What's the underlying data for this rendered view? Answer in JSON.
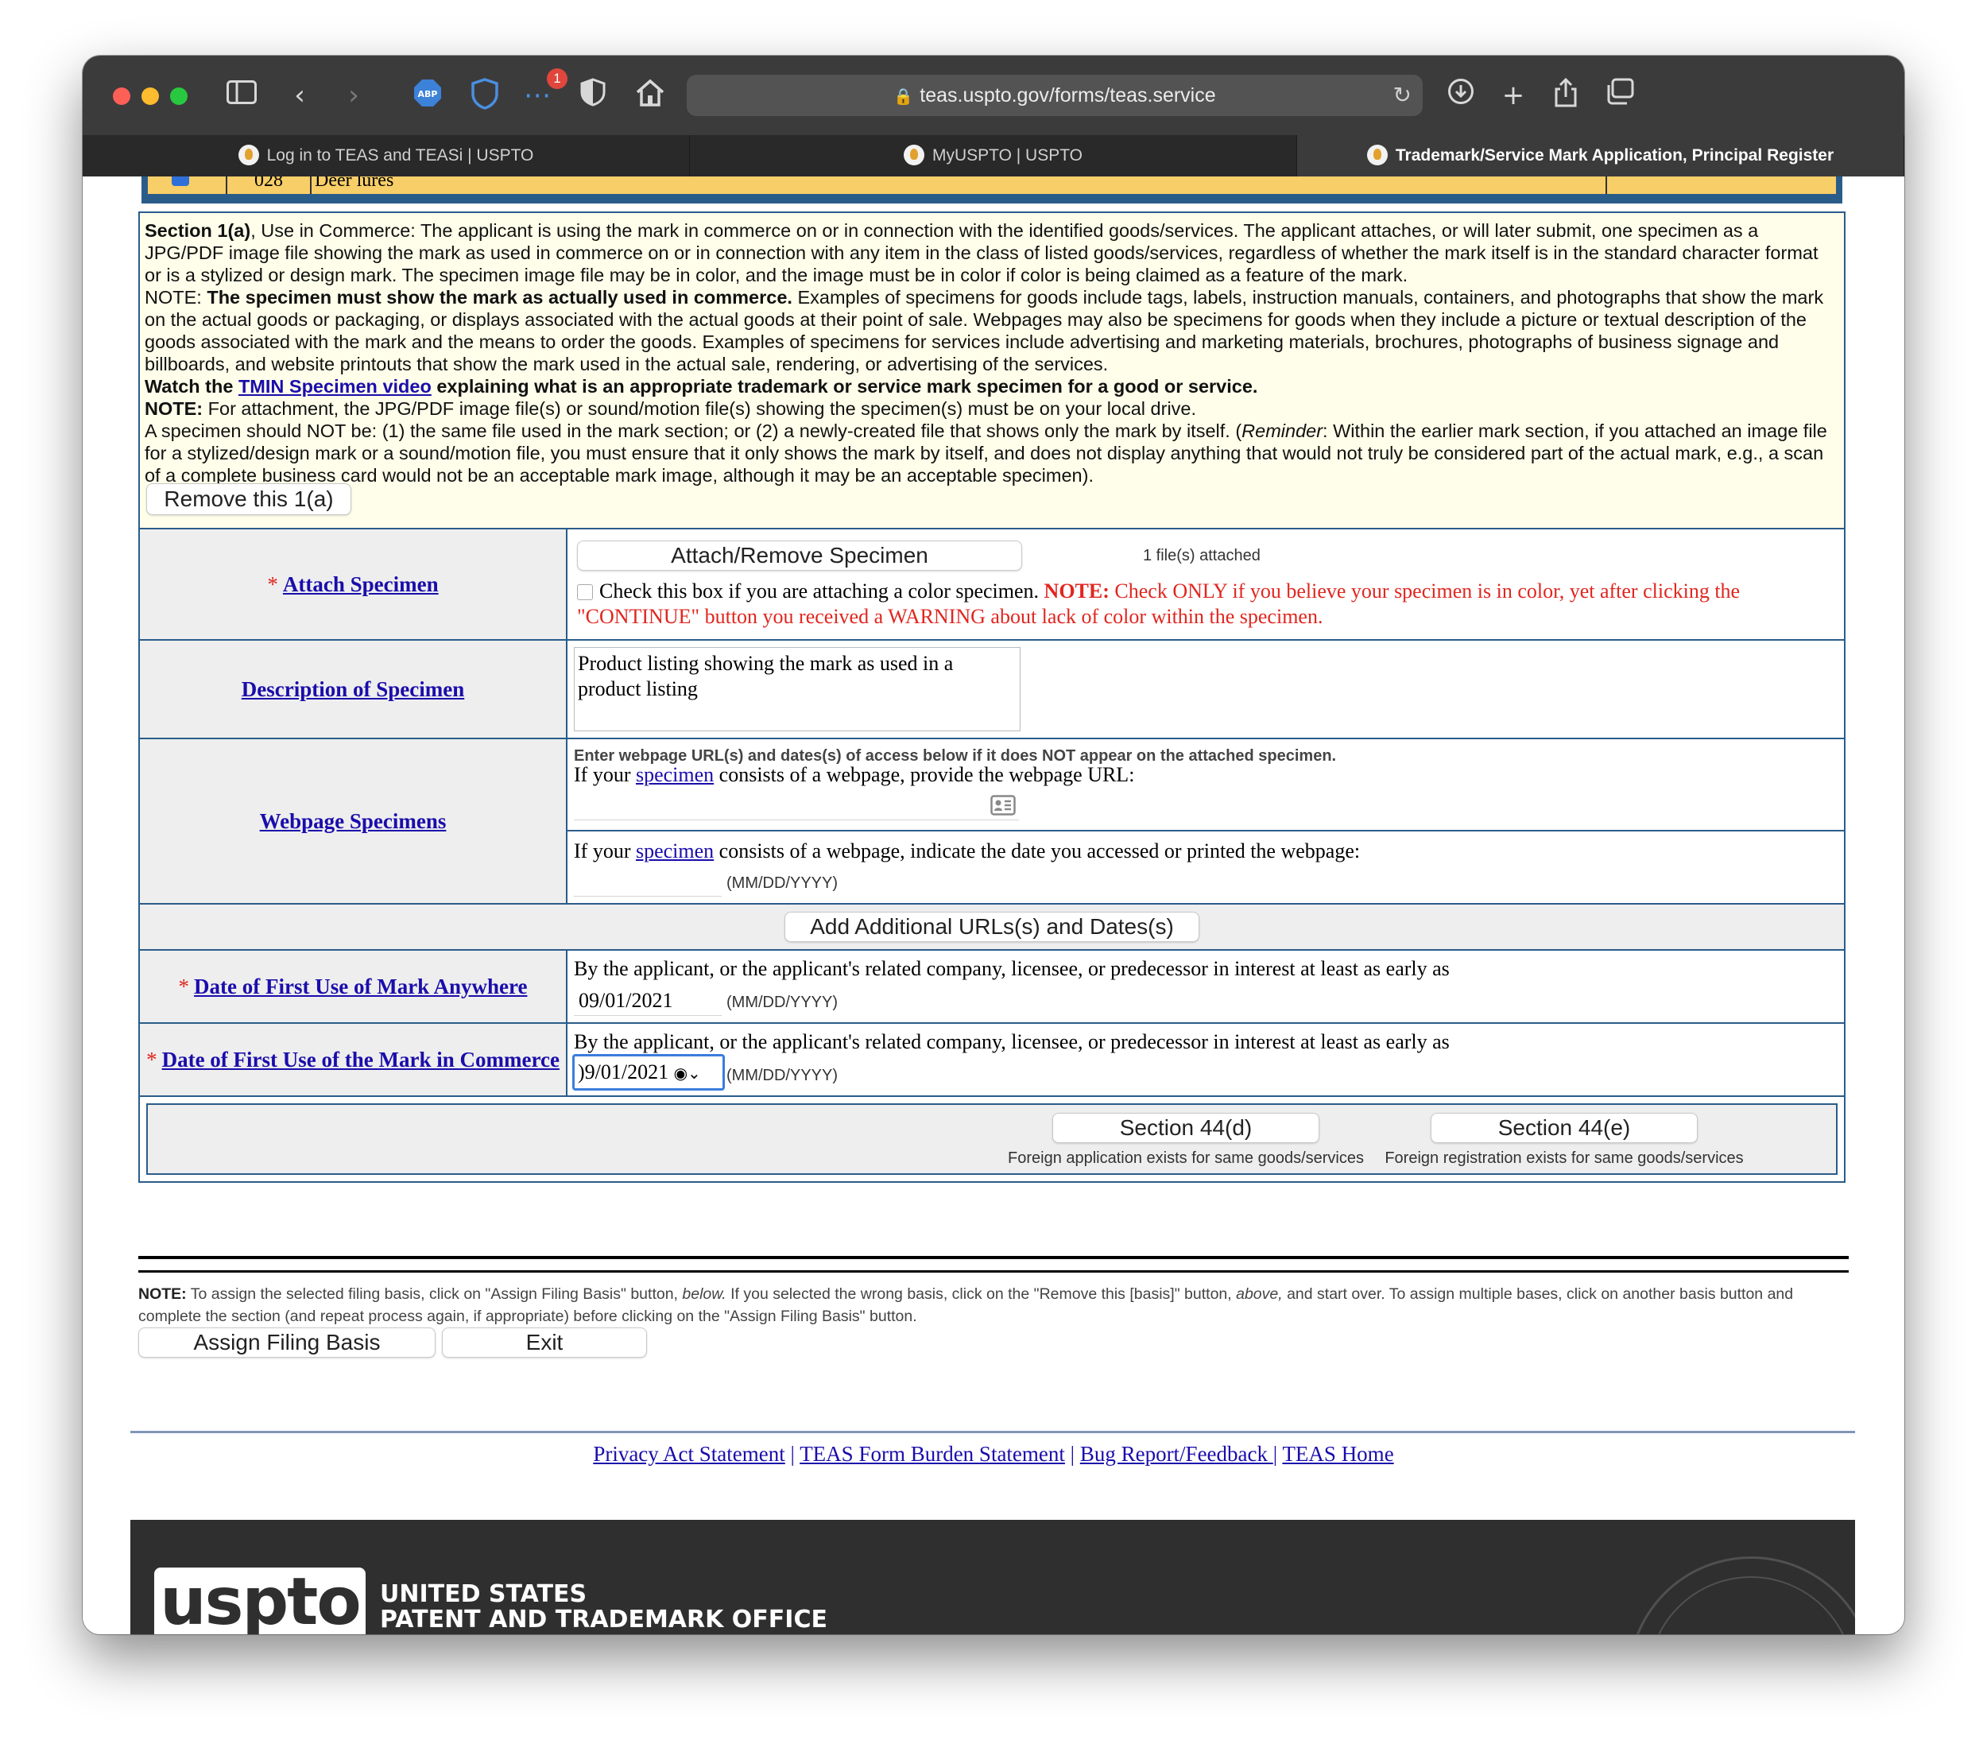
{
  "browser": {
    "url": "teas.uspto.gov/forms/teas.service",
    "badge_count": "1",
    "tabs": [
      {
        "label": "Log in to TEAS and TEASi | USPTO"
      },
      {
        "label": "MyUSPTO | USPTO"
      },
      {
        "label": "Trademark/Service Mark Application, Principal Register"
      }
    ]
  },
  "goods_row": {
    "class": "028",
    "description": "Deer lures"
  },
  "section_1a": {
    "p1_title": "Section 1(a)",
    "p1_text": ", Use in Commerce: The applicant is using the mark in commerce on or in connection with the identified goods/services. The applicant attaches, or will later submit, one specimen as a JPG/PDF image file showing the mark as used in commerce on or in connection with any item in the class of listed goods/services, regardless of whether the mark itself is in the standard character format or is a stylized or design mark. The specimen image file may be in color, and the image must be in color if color is being claimed as a feature of the mark.",
    "p2_prefix": "NOTE: ",
    "p2_bold": "The specimen must show the mark as actually used in commerce.",
    "p2_text": " Examples of specimens for goods include tags, labels, instruction manuals, containers, and photographs that show the mark on the actual goods or packaging, or displays associated with the actual goods at their point of sale. Webpages may also be specimens for goods when they include a picture or textual description of the goods associated with the mark and the means to order the goods. Examples of specimens for services include advertising and marketing materials, brochures, photographs of business signage and billboards, and website printouts that show the mark used in the actual sale, rendering, or advertising of the services.",
    "p3_before": "Watch the ",
    "p3_link": "TMIN Specimen video",
    "p3_after": " explaining what is an appropriate trademark or service mark specimen for a good or service.",
    "p4_bold": "NOTE:",
    "p4_text": " For attachment, the JPG/PDF image file(s) or sound/motion file(s) showing the specimen(s) must be on your local drive.",
    "p5_text": "A specimen should NOT be: (1) the same file used in the mark section; or (2) a newly-created file that shows only the mark by itself. (",
    "p5_italic": "Reminder",
    "p5_text2": ": Within the earlier mark section, if you attached an image file for a stylized/design mark or a sound/motion file, you must ensure that it only shows the mark by itself, and does not display anything that would not truly be considered part of the actual mark, e.g., a scan of a complete business card would not be an acceptable mark image, although it may be an acceptable specimen).",
    "remove_button": "Remove this 1(a)"
  },
  "form": {
    "required_mark": "*",
    "attach": {
      "label": "Attach Specimen",
      "button": "Attach/Remove Specimen",
      "files_attached": "1 file(s) attached",
      "checkbox_text": "Check this box if you are attaching a color specimen.",
      "note_bold": "NOTE:",
      "note_text": " Check ONLY if you believe your specimen is in color, yet after clicking the \"CONTINUE\" button you received a WARNING about lack of color within the specimen."
    },
    "description": {
      "label": "Description of Specimen",
      "value": "Product listing showing the mark as used in a product listing"
    },
    "webpage": {
      "label": "Webpage Specimens",
      "instruction": "Enter webpage URL(s) and dates(s) of access below if it does NOT appear on the attached specimen.",
      "url_prompt_before": "If your ",
      "url_prompt_link": "specimen",
      "url_prompt_after": " consists of a webpage, provide the webpage URL:",
      "url_value": "",
      "date_prompt_before": "If your ",
      "date_prompt_link": "specimen",
      "date_prompt_after": " consists of a webpage, indicate the date you accessed or printed the webpage:",
      "date_value": "",
      "date_format": "(MM/DD/YYYY)"
    },
    "add_urls_button": "Add Additional URLs(s) and Dates(s)",
    "first_use_anywhere": {
      "label": "Date of First Use of Mark Anywhere",
      "text": "By the applicant, or the applicant's related company, licensee, or predecessor in interest at least as early as",
      "value": "09/01/2021",
      "format": "(MM/DD/YYYY)"
    },
    "first_use_commerce": {
      "label": "Date of First Use of the Mark in Commerce",
      "text": "By the applicant, or the applicant's related company, licensee, or predecessor in interest at least as early as",
      "value": ")9/01/2021",
      "format": "(MM/DD/YYYY)"
    },
    "section_44d": {
      "button": "Section 44(d)",
      "caption": "Foreign application exists for same goods/services"
    },
    "section_44e": {
      "button": "Section 44(e)",
      "caption": "Foreign registration exists for same goods/services"
    }
  },
  "note": {
    "bold": "NOTE:",
    "t1": " To assign the selected filing basis, click on \"Assign Filing Basis\" button, ",
    "i1": "below.",
    "t2": " If you selected the wrong basis, click on the \"Remove this [basis]\" button, ",
    "i2": "above,",
    "t3": " and start over. To assign multiple bases, click on another basis button and complete the section (and repeat process again, if appropriate) before clicking on the \"Assign Filing Basis\" button."
  },
  "buttons": {
    "assign": "Assign Filing Basis",
    "exit": "Exit"
  },
  "footer": {
    "links": [
      "Privacy Act Statement",
      "TEAS Form Burden Statement",
      "Bug Report/Feedback ",
      "TEAS Home"
    ],
    "separator": " | ",
    "logo": "uspto",
    "office_line1": "UNITED STATES",
    "office_line2": "PATENT AND TRADEMARK OFFICE"
  },
  "colors": {
    "link": "#1a0dab",
    "required": "#e0261f",
    "table_border": "#2a5c8a",
    "section_bg": "#fefeea"
  }
}
